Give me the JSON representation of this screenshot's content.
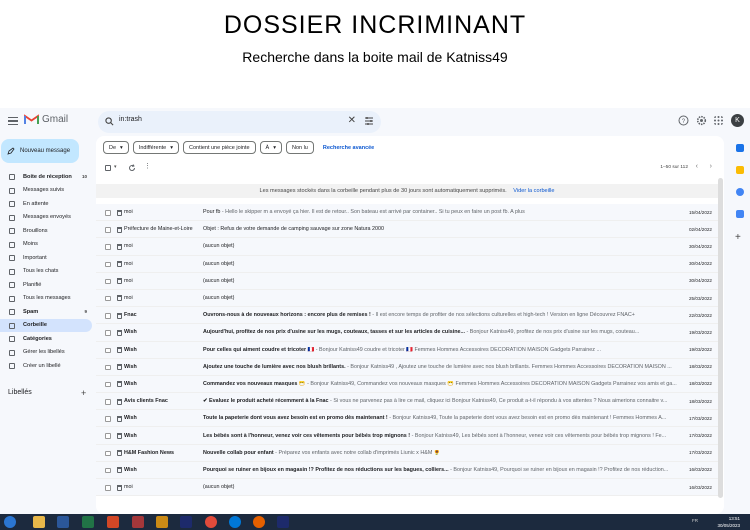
{
  "banner": {
    "title": "DOSSIER INCRIMINANT",
    "subtitle": "Recherche dans la boite mail de Katniss49"
  },
  "topbar": {
    "app_name": "Gmail",
    "search_value": "in:trash",
    "avatar_letter": "K"
  },
  "compose_label": "Nouveau message",
  "sidebar": {
    "items": [
      {
        "label": "Boite de réception",
        "count": "10",
        "icon": "inbox-icon"
      },
      {
        "label": "Messages suivis",
        "count": "",
        "icon": "star-icon"
      },
      {
        "label": "En attente",
        "count": "",
        "icon": "clock-icon"
      },
      {
        "label": "Messages envoyés",
        "count": "",
        "icon": "send-icon"
      },
      {
        "label": "Brouillons",
        "count": "",
        "icon": "draft-icon"
      },
      {
        "label": "Moins",
        "count": "",
        "icon": "chevron-up-icon"
      },
      {
        "label": "Important",
        "count": "",
        "icon": "label-important-icon"
      },
      {
        "label": "Tous les chats",
        "count": "",
        "icon": "chat-icon"
      },
      {
        "label": "Planifié",
        "count": "",
        "icon": "schedule-send-icon"
      },
      {
        "label": "Tous les messages",
        "count": "",
        "icon": "mail-icon"
      },
      {
        "label": "Spam",
        "count": "9",
        "icon": "spam-icon"
      },
      {
        "label": "Corbeille",
        "count": "",
        "icon": "trash-icon"
      },
      {
        "label": "Catégories",
        "count": "",
        "icon": "categories-icon"
      },
      {
        "label": "Gérer les libellés",
        "count": "",
        "icon": "settings-icon"
      },
      {
        "label": "Créer un libellé",
        "count": "",
        "icon": "plus-icon"
      }
    ],
    "labels_heading": "Libellés"
  },
  "filters": {
    "from": "De",
    "any_time": "Indifférente",
    "attachment": "Contient une pièce jointe",
    "to": "À",
    "unread": "Non lu",
    "advanced": "Recherche avancée"
  },
  "pager": "1–50 sur 112",
  "notice": {
    "text": "Les messages stockés dans la corbeille pendant plus de 30 jours sont automatiquement supprimés.",
    "link": "Vider la corbeille"
  },
  "emails": [
    {
      "sender": "moi",
      "subject": "Pour fb",
      "snippet": " - Hello le skipper m a envoyé ça hier. Il est de retour.. Son bateau est arrivé par container.. Si tu peux en faire un post fb. A plus",
      "date": "15/04/2022",
      "bold": false
    },
    {
      "sender": "Préfecture de Maine-et-Loire",
      "subject": "Objet : Refus de votre demande de camping sauvage sur zone Natura 2000",
      "snippet": "",
      "date": "02/04/2022",
      "bold": false
    },
    {
      "sender": "moi",
      "subject": "(aucun objet)",
      "snippet": "",
      "date": "30/04/2022",
      "bold": false
    },
    {
      "sender": "moi",
      "subject": "(aucun objet)",
      "snippet": "",
      "date": "30/04/2022",
      "bold": false
    },
    {
      "sender": "moi",
      "subject": "(aucun objet)",
      "snippet": "",
      "date": "30/04/2022",
      "bold": false
    },
    {
      "sender": "moi",
      "subject": "(aucun objet)",
      "snippet": "",
      "date": "25/03/2022",
      "bold": false
    },
    {
      "sender": "Fnac",
      "subject": "Ouvrons-nous à de nouveaux horizons : encore plus de remises !",
      "snippet": " - Il est encore temps de profiter de nos sélections culturelles et high-tech ! Version en ligne Découvrez FNAC+",
      "date": "22/03/2022",
      "bold": true
    },
    {
      "sender": "Wish",
      "subject": "Aujourd'hui, profitez de nos prix d'usine sur les mugs, couteaux, tasses et sur les articles de cuisine...",
      "snippet": " - Bonjour Katniss49, profitez de nos prix d'usine sur les mugs, couteau...",
      "date": "19/03/2022",
      "bold": true
    },
    {
      "sender": "Wish",
      "subject": "Pour celles qui aiment coudre et tricoter 🇫🇷",
      "snippet": " - Bonjour Katniss49 coudre et tricoter 🇫🇷 Femmes Hommes Accessoires DÉCORATION MAISON Gadgets Parrainez ...",
      "date": "19/03/2022",
      "bold": true
    },
    {
      "sender": "Wish",
      "subject": "Ajoutez une touche de lumière avec nos blush brillants.",
      "snippet": " - Bonjour Katniss49 , Ajoutez une touche de lumière avec nos blush brillants. Femmes Hommes Accessoires DÉCORATION MAISON ...",
      "date": "18/03/2022",
      "bold": true
    },
    {
      "sender": "Wish",
      "subject": "Commandez vos nouveaux masques 😷",
      "snippet": " - Bonjour Katniss49, Commandez vos nouveaux masques 😷 Femmes Hommes Accessoires DÉCORATION MAISON Gadgets Parrainez vos amis et ga...",
      "date": "18/03/2022",
      "bold": true
    },
    {
      "sender": "Avis clients Fnac",
      "subject": "✔ Evaluez le produit acheté récemment à la Fnac",
      "snippet": " - Si vous ne parvenez pas à lire ce mail, cliquez ici Bonjour Katniss49, Ce produit a-t-il répondu à vos attentes ? Nous aimerions connaitre v...",
      "date": "18/03/2022",
      "bold": true
    },
    {
      "sender": "Wish",
      "subject": "Toute la papeterie dont vous avez besoin est en promo dès maintenant !",
      "snippet": " - Bonjour Katniss49, Toute la papeterie dont vous avez besoin est en promo dès maintenant ! Femmes Hommes A...",
      "date": "17/03/2022",
      "bold": true
    },
    {
      "sender": "Wish",
      "subject": "Les bébés sont à l'honneur, venez voir ces vêtements pour bébés trop mignons !",
      "snippet": " - Bonjour Katniss49, Les bébés sont à l'honneur, venez voir ces vêtements pour bébés trop mignons ! Fe...",
      "date": "17/03/2022",
      "bold": true
    },
    {
      "sender": "H&M Fashion News",
      "subject": "Nouvelle collab pour enfant",
      "snippet": " - Préparez vos enfants avec notre collab d'imprimés Liunic x H&M 🌻",
      "date": "17/03/2022",
      "bold": true
    },
    {
      "sender": "Wish",
      "subject": "Pourquoi se ruiner en bijoux en magasin !? Profitez de nos réductions sur les bagues, colliers...",
      "snippet": " - Bonjour Katniss49, Pourquoi se ruiner en bijoux en magasin !? Profitez de nos réduction...",
      "date": "16/03/2022",
      "bold": true
    },
    {
      "sender": "moi",
      "subject": "(aucun objet)",
      "snippet": "",
      "date": "16/03/2022",
      "bold": false
    }
  ],
  "clock": {
    "time": "13:51",
    "date": "30/05/2023"
  },
  "tray": "FR",
  "colors": {
    "accent": "#0b57d0",
    "compose": "#c2e7ff",
    "active": "#d3e3fd",
    "taskbar": "#1c2a3e"
  }
}
